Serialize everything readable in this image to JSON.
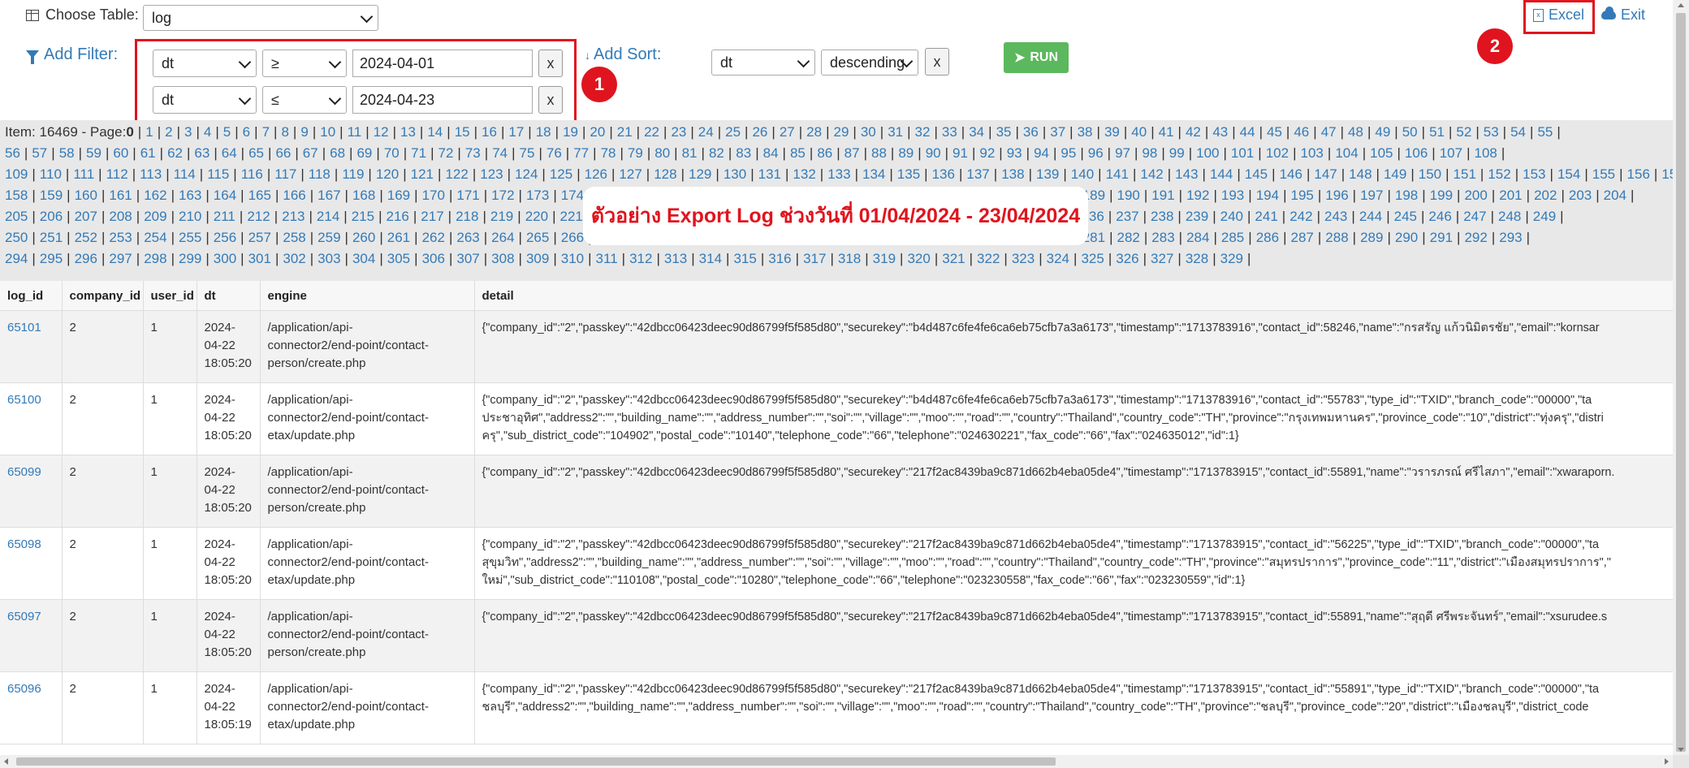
{
  "toolbar": {
    "choose_table_label": "Choose Table:",
    "table_value": "log",
    "add_filter_label": "Add Filter:",
    "filters": [
      {
        "field": "dt",
        "op": "≥",
        "value": "2024-04-01",
        "remove": "x"
      },
      {
        "field": "dt",
        "op": "≤",
        "value": "2024-04-23",
        "remove": "x"
      }
    ],
    "add_sort_label": "Add Sort:",
    "sort_field": "dt",
    "sort_order": "descending",
    "sort_remove": "x",
    "run_label": "RUN",
    "excel_label": "Excel",
    "exit_label": "Exit"
  },
  "annotations": {
    "badge1": "1",
    "badge2": "2",
    "note": "ตัวอย่าง Export Log ช่วงวันที่ 01/04/2024 - 23/04/2024"
  },
  "pager": {
    "item_label": "Item: 16469 - Page:",
    "current_page": "0",
    "total_pages": 329
  },
  "table": {
    "headers": [
      "log_id",
      "company_id",
      "user_id",
      "dt",
      "engine",
      "detail"
    ],
    "rows": [
      {
        "log_id": "65101",
        "company_id": "2",
        "user_id": "1",
        "dt": "2024-\n04-22\n18:05:20",
        "engine": "/application/api-\nconnector2/end-point/contact-\nperson/create.php",
        "detail": "{\"company_id\":\"2\",\"passkey\":\"42dbcc06423deec90d86799f5f585d80\",\"securekey\":\"b4d487c6fe4fe6ca6eb75cfb7a3a6173\",\"timestamp\":\"1713783916\",\"contact_id\":58246,\"name\":\"กรสรัญ แก้วนิมิตรชัย\",\"email\":\"kornsar"
      },
      {
        "log_id": "65100",
        "company_id": "2",
        "user_id": "1",
        "dt": "2024-\n04-22\n18:05:20",
        "engine": "/application/api-\nconnector2/end-point/contact-\netax/update.php",
        "detail": "{\"company_id\":\"2\",\"passkey\":\"42dbcc06423deec90d86799f5f585d80\",\"securekey\":\"b4d487c6fe4fe6ca6eb75cfb7a3a6173\",\"timestamp\":\"1713783916\",\"contact_id\":\"55783\",\"type_id\":\"TXID\",\"branch_code\":\"00000\",\"ta\nประชาอุทิศ\",\"address2\":\"\",\"building_name\":\"\",\"address_number\":\"\",\"soi\":\"\",\"village\":\"\",\"moo\":\"\",\"road\":\"\",\"country\":\"Thailand\",\"country_code\":\"TH\",\"province\":\"กรุงเทพมหานคร\",\"province_code\":\"10\",\"district\":\"ทุ่งครุ\",\"distri\nครุ\",\"sub_district_code\":\"104902\",\"postal_code\":\"10140\",\"telephone_code\":\"66\",\"telephone\":\"024630221\",\"fax_code\":\"66\",\"fax\":\"024635012\",\"id\":1}"
      },
      {
        "log_id": "65099",
        "company_id": "2",
        "user_id": "1",
        "dt": "2024-\n04-22\n18:05:20",
        "engine": "/application/api-\nconnector2/end-point/contact-\nperson/create.php",
        "detail": "{\"company_id\":\"2\",\"passkey\":\"42dbcc06423deec90d86799f5f585d80\",\"securekey\":\"217f2ac8439ba9c871d662b4eba05de4\",\"timestamp\":\"1713783915\",\"contact_id\":55891,\"name\":\"วรารภรณ์ ศรีไสภา\",\"email\":\"xwaraporn."
      },
      {
        "log_id": "65098",
        "company_id": "2",
        "user_id": "1",
        "dt": "2024-\n04-22\n18:05:20",
        "engine": "/application/api-\nconnector2/end-point/contact-\netax/update.php",
        "detail": "{\"company_id\":\"2\",\"passkey\":\"42dbcc06423deec90d86799f5f585d80\",\"securekey\":\"217f2ac8439ba9c871d662b4eba05de4\",\"timestamp\":\"1713783915\",\"contact_id\":\"56225\",\"type_id\":\"TXID\",\"branch_code\":\"00000\",\"ta\nสุขุมวิท\",\"address2\":\"\",\"building_name\":\"\",\"address_number\":\"\",\"soi\":\"\",\"village\":\"\",\"moo\":\"\",\"road\":\"\",\"country\":\"Thailand\",\"country_code\":\"TH\",\"province\":\"สมุทรปราการ\",\"province_code\":\"11\",\"district\":\"เมืองสมุทรปราการ\",\"\nใหม่\",\"sub_district_code\":\"110108\",\"postal_code\":\"10280\",\"telephone_code\":\"66\",\"telephone\":\"023230558\",\"fax_code\":\"66\",\"fax\":\"023230559\",\"id\":1}"
      },
      {
        "log_id": "65097",
        "company_id": "2",
        "user_id": "1",
        "dt": "2024-\n04-22\n18:05:20",
        "engine": "/application/api-\nconnector2/end-point/contact-\nperson/create.php",
        "detail": "{\"company_id\":\"2\",\"passkey\":\"42dbcc06423deec90d86799f5f585d80\",\"securekey\":\"217f2ac8439ba9c871d662b4eba05de4\",\"timestamp\":\"1713783915\",\"contact_id\":55891,\"name\":\"สุฤดี ศรีพระจันทร์\",\"email\":\"xsurudee.s"
      },
      {
        "log_id": "65096",
        "company_id": "2",
        "user_id": "1",
        "dt": "2024-\n04-22\n18:05:19",
        "engine": "/application/api-\nconnector2/end-point/contact-\netax/update.php",
        "detail": "{\"company_id\":\"2\",\"passkey\":\"42dbcc06423deec90d86799f5f585d80\",\"securekey\":\"217f2ac8439ba9c871d662b4eba05de4\",\"timestamp\":\"1713783915\",\"contact_id\":\"55891\",\"type_id\":\"TXID\",\"branch_code\":\"00000\",\"ta\nชลบุรี\",\"address2\":\"\",\"building_name\":\"\",\"address_number\":\"\",\"soi\":\"\",\"village\":\"\",\"moo\":\"\",\"road\":\"\",\"country\":\"Thailand\",\"country_code\":\"TH\",\"province\":\"ชลบุรี\",\"province_code\":\"20\",\"district\":\"เมืองชลบุรี\",\"district_code"
      }
    ]
  },
  "colors": {
    "link": "#337ab7",
    "run": "#5cb85c",
    "annotation_red": "#e0141e",
    "pager_bg": "#e8e8e8"
  }
}
